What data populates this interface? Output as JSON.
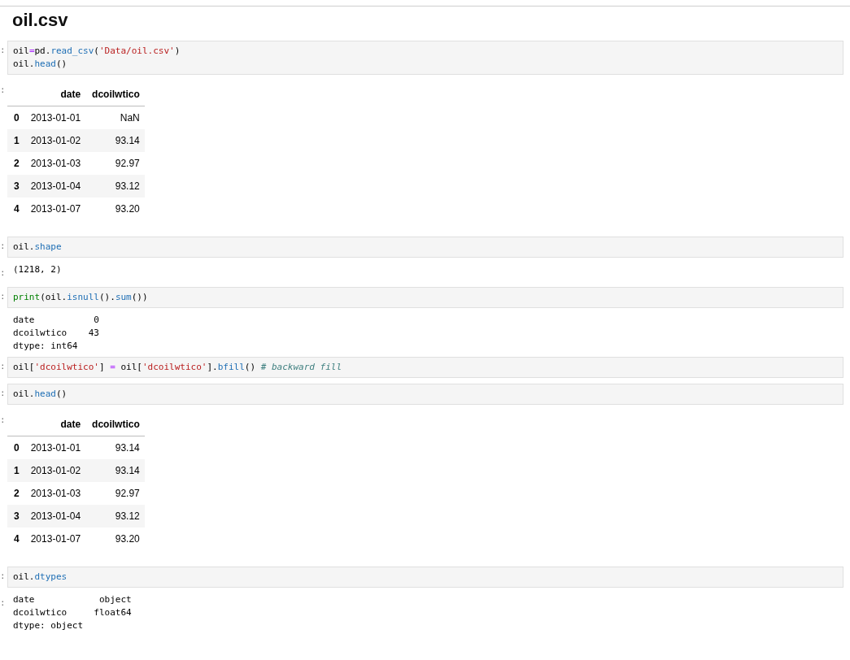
{
  "title": "oil.csv",
  "cells": [
    {
      "kind": "code",
      "prompt": ":",
      "lines": [
        [
          {
            "text": "oil",
            "kind": "name"
          },
          {
            "text": "=",
            "kind": "op"
          },
          {
            "text": "pd.",
            "kind": "name"
          },
          {
            "text": "read_csv",
            "kind": "attr"
          },
          {
            "text": "(",
            "kind": "name"
          },
          {
            "text": "'Data/oil.csv'",
            "kind": "string"
          },
          {
            "text": ")",
            "kind": "name"
          }
        ],
        [
          {
            "text": "oil.",
            "kind": "name"
          },
          {
            "text": "head",
            "kind": "attr"
          },
          {
            "text": "()",
            "kind": "name"
          }
        ]
      ]
    },
    {
      "kind": "table",
      "prompt": ":",
      "columns": [
        "date",
        "dcoilwtico"
      ],
      "rows": [
        {
          "index": "0",
          "cells": [
            "2013-01-01",
            "NaN"
          ]
        },
        {
          "index": "1",
          "cells": [
            "2013-01-02",
            "93.14"
          ]
        },
        {
          "index": "2",
          "cells": [
            "2013-01-03",
            "92.97"
          ]
        },
        {
          "index": "3",
          "cells": [
            "2013-01-04",
            "93.12"
          ]
        },
        {
          "index": "4",
          "cells": [
            "2013-01-07",
            "93.20"
          ]
        }
      ]
    },
    {
      "kind": "code",
      "prompt": ":",
      "lines": [
        [
          {
            "text": "oil.",
            "kind": "name"
          },
          {
            "text": "shape",
            "kind": "attr"
          }
        ]
      ]
    },
    {
      "kind": "text",
      "prompt": ":",
      "lines": [
        "(1218, 2)"
      ]
    },
    {
      "kind": "code",
      "prompt": ":",
      "lines": [
        [
          {
            "text": "print",
            "kind": "builtin"
          },
          {
            "text": "(oil.",
            "kind": "name"
          },
          {
            "text": "isnull",
            "kind": "attr"
          },
          {
            "text": "().",
            "kind": "name"
          },
          {
            "text": "sum",
            "kind": "attr"
          },
          {
            "text": "())",
            "kind": "name"
          }
        ]
      ]
    },
    {
      "kind": "text",
      "lines": [
        "date           0",
        "dcoilwtico    43",
        "dtype: int64"
      ]
    },
    {
      "kind": "code",
      "prompt": ":",
      "lines": [
        [
          {
            "text": "oil[",
            "kind": "name"
          },
          {
            "text": "'dcoilwtico'",
            "kind": "string"
          },
          {
            "text": "] ",
            "kind": "name"
          },
          {
            "text": "=",
            "kind": "op"
          },
          {
            "text": " oil[",
            "kind": "name"
          },
          {
            "text": "'dcoilwtico'",
            "kind": "string"
          },
          {
            "text": "].",
            "kind": "name"
          },
          {
            "text": "bfill",
            "kind": "attr"
          },
          {
            "text": "() ",
            "kind": "name"
          },
          {
            "text": "# backward fill",
            "kind": "comment"
          }
        ]
      ]
    },
    {
      "kind": "code",
      "prompt": ":",
      "lines": [
        [
          {
            "text": "oil.",
            "kind": "name"
          },
          {
            "text": "head",
            "kind": "attr"
          },
          {
            "text": "()",
            "kind": "name"
          }
        ]
      ]
    },
    {
      "kind": "table",
      "prompt": ":",
      "columns": [
        "date",
        "dcoilwtico"
      ],
      "rows": [
        {
          "index": "0",
          "cells": [
            "2013-01-01",
            "93.14"
          ]
        },
        {
          "index": "1",
          "cells": [
            "2013-01-02",
            "93.14"
          ]
        },
        {
          "index": "2",
          "cells": [
            "2013-01-03",
            "92.97"
          ]
        },
        {
          "index": "3",
          "cells": [
            "2013-01-04",
            "93.12"
          ]
        },
        {
          "index": "4",
          "cells": [
            "2013-01-07",
            "93.20"
          ]
        }
      ]
    },
    {
      "kind": "code",
      "prompt": ":",
      "lines": [
        [
          {
            "text": "oil.",
            "kind": "name"
          },
          {
            "text": "dtypes",
            "kind": "attr"
          }
        ]
      ]
    },
    {
      "kind": "text",
      "prompt": ":",
      "lines": [
        "date            object",
        "dcoilwtico     float64",
        "dtype: object"
      ]
    }
  ]
}
